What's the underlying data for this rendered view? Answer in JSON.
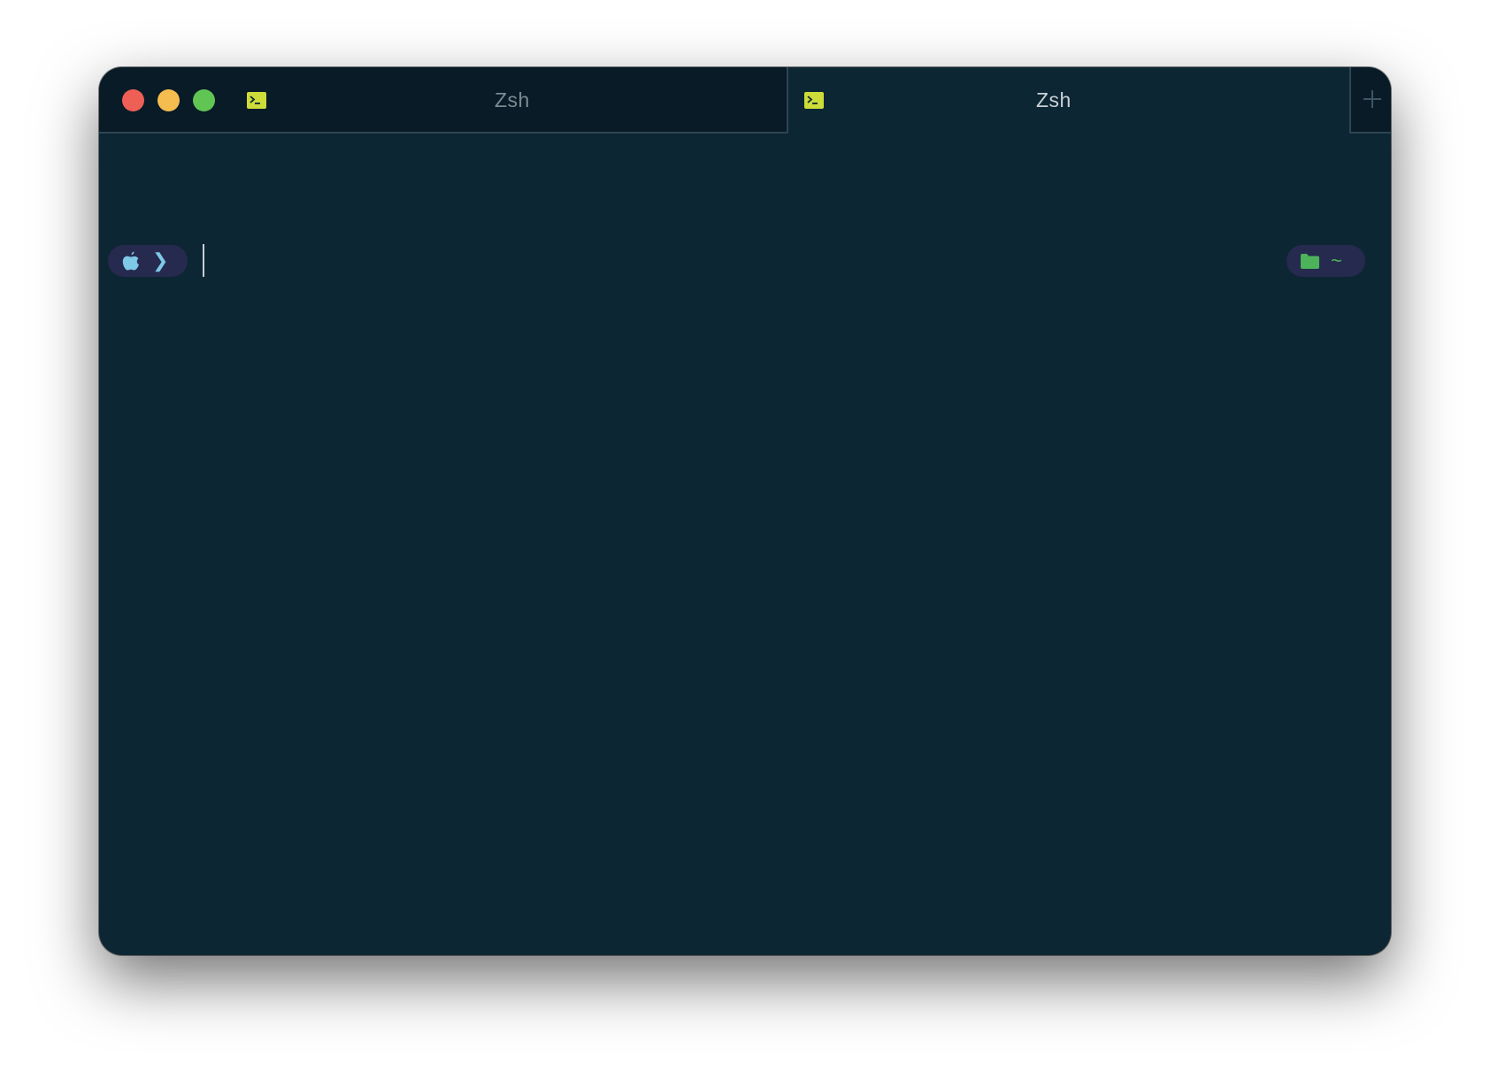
{
  "colors": {
    "window_bg": "#0d2633",
    "inactive_tab_bg": "#081b27",
    "pill_bg": "#262a4e",
    "traffic_close": "#ee5f56",
    "traffic_minimize": "#f5bd4f",
    "traffic_zoom": "#61c554",
    "terminal_icon": "#cddc39",
    "apple_icon": "#7ec8e8",
    "folder_icon": "#4cb35a"
  },
  "traffic_lights": {
    "close": "close-button",
    "minimize": "minimize-button",
    "zoom": "zoom-button"
  },
  "tabs": [
    {
      "title": "Zsh",
      "icon": "terminal-icon",
      "active": false
    },
    {
      "title": "Zsh",
      "icon": "terminal-icon",
      "active": true
    }
  ],
  "new_tab": {
    "icon": "plus-icon"
  },
  "prompt": {
    "left_segment": {
      "icons": [
        "apple-icon",
        "chevron-right-icon"
      ],
      "chevron": "❯"
    },
    "right_segment": {
      "icons": [
        "folder-icon"
      ],
      "path": "~"
    }
  }
}
